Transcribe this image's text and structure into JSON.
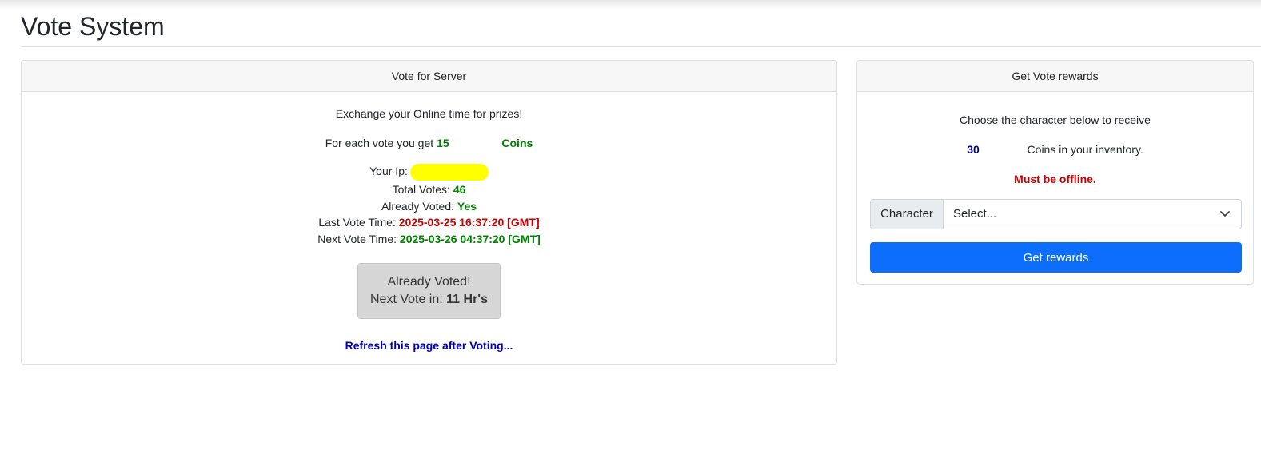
{
  "page": {
    "title": "Vote System"
  },
  "vote_panel": {
    "header": "Vote for Server",
    "exchange_text": "Exchange your Online time for prizes!",
    "per_vote_prefix": "For each vote you get",
    "per_vote_amount": "15",
    "per_vote_unit": "Coins",
    "ip_label": "Your Ip:",
    "total_votes_label": "Total Votes:",
    "total_votes_value": "46",
    "already_voted_label": "Already Voted:",
    "already_voted_value": "Yes",
    "last_vote_label": "Last Vote Time:",
    "last_vote_value": "2025-03-25 16:37:20 [GMT]",
    "next_vote_label": "Next Vote Time:",
    "next_vote_value": "2025-03-26 04:37:20 [GMT]",
    "button_line1": "Already Voted!",
    "button_line2_prefix": "Next Vote in:",
    "button_line2_value": "11 Hr's",
    "refresh_text": "Refresh this page after Voting..."
  },
  "reward_panel": {
    "header": "Get Vote rewards",
    "choose_text": "Choose the character below to receive",
    "coins_amount": "30",
    "coins_text": "Coins in your inventory.",
    "warning": "Must be offline.",
    "character_label": "Character",
    "select_value": "Select...",
    "button_label": "Get rewards"
  },
  "colors": {
    "green": "#008000",
    "red": "#cc0000",
    "navy": "#00008b",
    "primary": "#0d6efd",
    "ip_mask": "#ffff00"
  }
}
